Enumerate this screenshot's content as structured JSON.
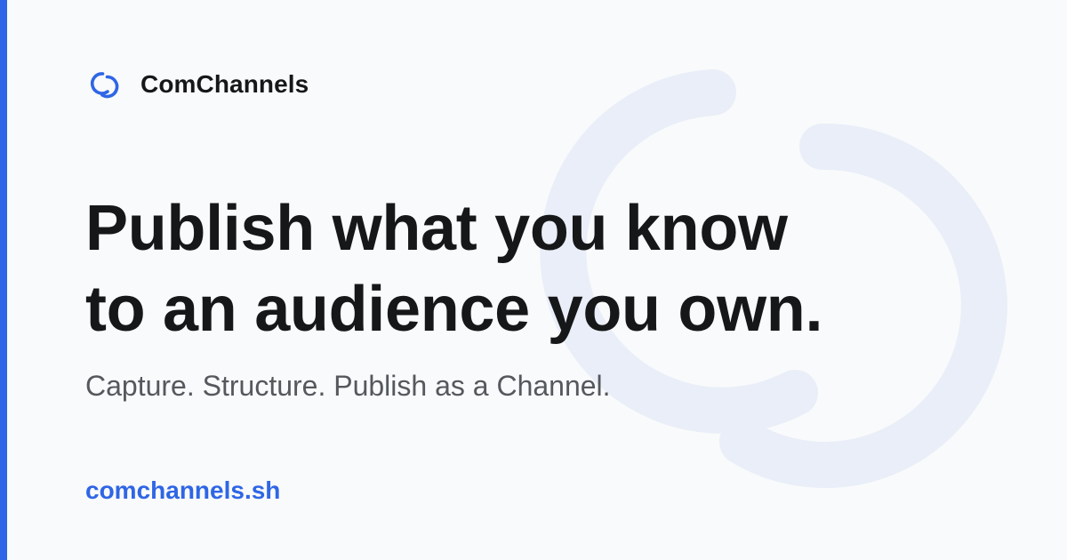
{
  "brand": {
    "name": "ComChannels",
    "icon": "swirl-logo-icon"
  },
  "headline": {
    "line1": "Publish what you know",
    "line2": "to an audience you own."
  },
  "tagline": "Capture. Structure. Publish as a Channel.",
  "url": "comchannels.sh",
  "colors": {
    "accent": "#2f66e5",
    "text": "#161718",
    "muted": "#55585d",
    "background": "#f9fafb",
    "watermark": "#e9eef8"
  }
}
